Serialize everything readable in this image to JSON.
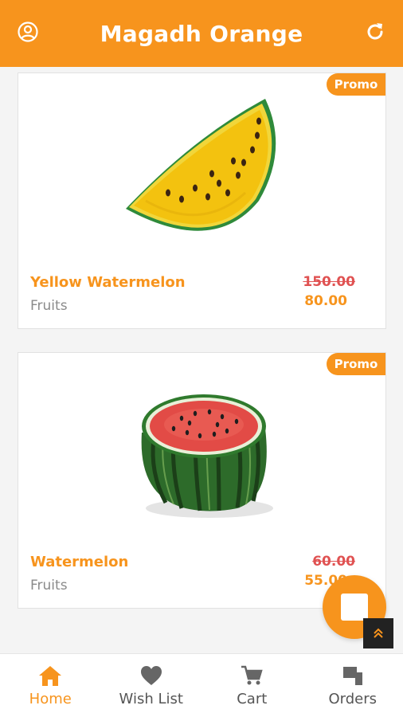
{
  "app": {
    "title": "Magadh Orange",
    "accent_color": "#f7941d",
    "left_icon": "user-circle-icon",
    "right_icon": "refresh-icon"
  },
  "products": [
    {
      "name": "Yellow Watermelon",
      "category": "Fruits",
      "old_price": "150.00",
      "new_price": "80.00",
      "badge": "Promo",
      "image": "yellow-watermelon-slice"
    },
    {
      "name": "Watermelon",
      "category": "Fruits",
      "old_price": "60.00",
      "new_price": "55.00",
      "badge": "Promo",
      "image": "watermelon-half"
    }
  ],
  "fab": {
    "icon": "square-icon"
  },
  "scroll_top": {
    "icon": "chevron-double-up-icon"
  },
  "nav": {
    "items": [
      {
        "label": "Home",
        "icon": "home-icon",
        "active": true
      },
      {
        "label": "Wish List",
        "icon": "heart-icon",
        "active": false
      },
      {
        "label": "Cart",
        "icon": "cart-icon",
        "active": false
      },
      {
        "label": "Orders",
        "icon": "orders-icon",
        "active": false
      }
    ]
  }
}
